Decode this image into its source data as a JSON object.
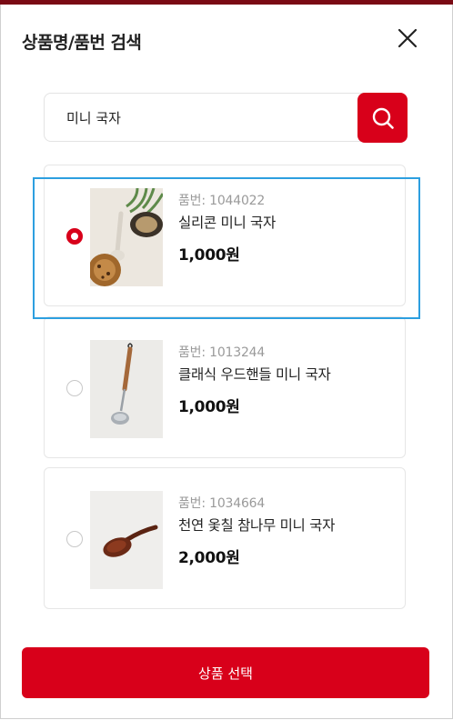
{
  "header": {
    "title": "상품명/품번 검색"
  },
  "search": {
    "value": "미니 국자"
  },
  "products": [
    {
      "code": "품번: 1044022",
      "name": "실리콘 미니 국자",
      "price": "1,000원",
      "selected": true
    },
    {
      "code": "품번: 1013244",
      "name": "클래식 우드핸들 미니 국자",
      "price": "1,000원",
      "selected": false
    },
    {
      "code": "품번: 1034664",
      "name": "천연 옻칠 참나무 미니 국자",
      "price": "2,000원",
      "selected": false
    }
  ],
  "footer": {
    "select_label": "상품 선택"
  },
  "colors": {
    "accent": "#d8001a",
    "top_bar": "#7a0a14",
    "highlight": "#2d9fe0"
  },
  "icons": {
    "close": "close-icon",
    "search": "search-icon"
  }
}
